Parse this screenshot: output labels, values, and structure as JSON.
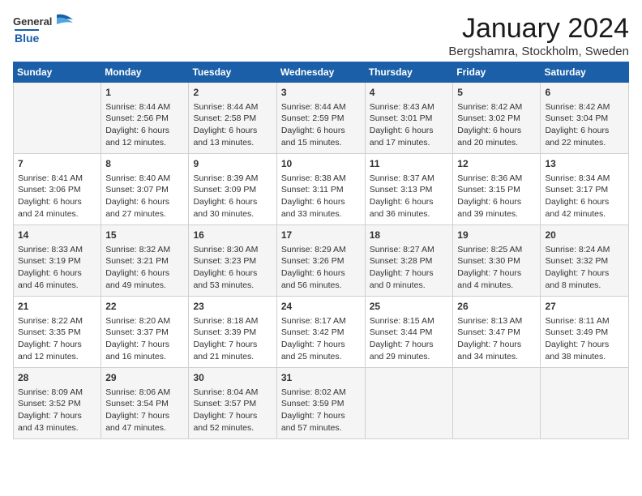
{
  "logo": {
    "general": "General",
    "blue": "Blue"
  },
  "title": "January 2024",
  "subtitle": "Bergshamra, Stockholm, Sweden",
  "days_header": [
    "Sunday",
    "Monday",
    "Tuesday",
    "Wednesday",
    "Thursday",
    "Friday",
    "Saturday"
  ],
  "weeks": [
    [
      {
        "day": "",
        "info": ""
      },
      {
        "day": "1",
        "info": "Sunrise: 8:44 AM\nSunset: 2:56 PM\nDaylight: 6 hours\nand 12 minutes."
      },
      {
        "day": "2",
        "info": "Sunrise: 8:44 AM\nSunset: 2:58 PM\nDaylight: 6 hours\nand 13 minutes."
      },
      {
        "day": "3",
        "info": "Sunrise: 8:44 AM\nSunset: 2:59 PM\nDaylight: 6 hours\nand 15 minutes."
      },
      {
        "day": "4",
        "info": "Sunrise: 8:43 AM\nSunset: 3:01 PM\nDaylight: 6 hours\nand 17 minutes."
      },
      {
        "day": "5",
        "info": "Sunrise: 8:42 AM\nSunset: 3:02 PM\nDaylight: 6 hours\nand 20 minutes."
      },
      {
        "day": "6",
        "info": "Sunrise: 8:42 AM\nSunset: 3:04 PM\nDaylight: 6 hours\nand 22 minutes."
      }
    ],
    [
      {
        "day": "7",
        "info": "Sunrise: 8:41 AM\nSunset: 3:06 PM\nDaylight: 6 hours\nand 24 minutes."
      },
      {
        "day": "8",
        "info": "Sunrise: 8:40 AM\nSunset: 3:07 PM\nDaylight: 6 hours\nand 27 minutes."
      },
      {
        "day": "9",
        "info": "Sunrise: 8:39 AM\nSunset: 3:09 PM\nDaylight: 6 hours\nand 30 minutes."
      },
      {
        "day": "10",
        "info": "Sunrise: 8:38 AM\nSunset: 3:11 PM\nDaylight: 6 hours\nand 33 minutes."
      },
      {
        "day": "11",
        "info": "Sunrise: 8:37 AM\nSunset: 3:13 PM\nDaylight: 6 hours\nand 36 minutes."
      },
      {
        "day": "12",
        "info": "Sunrise: 8:36 AM\nSunset: 3:15 PM\nDaylight: 6 hours\nand 39 minutes."
      },
      {
        "day": "13",
        "info": "Sunrise: 8:34 AM\nSunset: 3:17 PM\nDaylight: 6 hours\nand 42 minutes."
      }
    ],
    [
      {
        "day": "14",
        "info": "Sunrise: 8:33 AM\nSunset: 3:19 PM\nDaylight: 6 hours\nand 46 minutes."
      },
      {
        "day": "15",
        "info": "Sunrise: 8:32 AM\nSunset: 3:21 PM\nDaylight: 6 hours\nand 49 minutes."
      },
      {
        "day": "16",
        "info": "Sunrise: 8:30 AM\nSunset: 3:23 PM\nDaylight: 6 hours\nand 53 minutes."
      },
      {
        "day": "17",
        "info": "Sunrise: 8:29 AM\nSunset: 3:26 PM\nDaylight: 6 hours\nand 56 minutes."
      },
      {
        "day": "18",
        "info": "Sunrise: 8:27 AM\nSunset: 3:28 PM\nDaylight: 7 hours\nand 0 minutes."
      },
      {
        "day": "19",
        "info": "Sunrise: 8:25 AM\nSunset: 3:30 PM\nDaylight: 7 hours\nand 4 minutes."
      },
      {
        "day": "20",
        "info": "Sunrise: 8:24 AM\nSunset: 3:32 PM\nDaylight: 7 hours\nand 8 minutes."
      }
    ],
    [
      {
        "day": "21",
        "info": "Sunrise: 8:22 AM\nSunset: 3:35 PM\nDaylight: 7 hours\nand 12 minutes."
      },
      {
        "day": "22",
        "info": "Sunrise: 8:20 AM\nSunset: 3:37 PM\nDaylight: 7 hours\nand 16 minutes."
      },
      {
        "day": "23",
        "info": "Sunrise: 8:18 AM\nSunset: 3:39 PM\nDaylight: 7 hours\nand 21 minutes."
      },
      {
        "day": "24",
        "info": "Sunrise: 8:17 AM\nSunset: 3:42 PM\nDaylight: 7 hours\nand 25 minutes."
      },
      {
        "day": "25",
        "info": "Sunrise: 8:15 AM\nSunset: 3:44 PM\nDaylight: 7 hours\nand 29 minutes."
      },
      {
        "day": "26",
        "info": "Sunrise: 8:13 AM\nSunset: 3:47 PM\nDaylight: 7 hours\nand 34 minutes."
      },
      {
        "day": "27",
        "info": "Sunrise: 8:11 AM\nSunset: 3:49 PM\nDaylight: 7 hours\nand 38 minutes."
      }
    ],
    [
      {
        "day": "28",
        "info": "Sunrise: 8:09 AM\nSunset: 3:52 PM\nDaylight: 7 hours\nand 43 minutes."
      },
      {
        "day": "29",
        "info": "Sunrise: 8:06 AM\nSunset: 3:54 PM\nDaylight: 7 hours\nand 47 minutes."
      },
      {
        "day": "30",
        "info": "Sunrise: 8:04 AM\nSunset: 3:57 PM\nDaylight: 7 hours\nand 52 minutes."
      },
      {
        "day": "31",
        "info": "Sunrise: 8:02 AM\nSunset: 3:59 PM\nDaylight: 7 hours\nand 57 minutes."
      },
      {
        "day": "",
        "info": ""
      },
      {
        "day": "",
        "info": ""
      },
      {
        "day": "",
        "info": ""
      }
    ]
  ]
}
